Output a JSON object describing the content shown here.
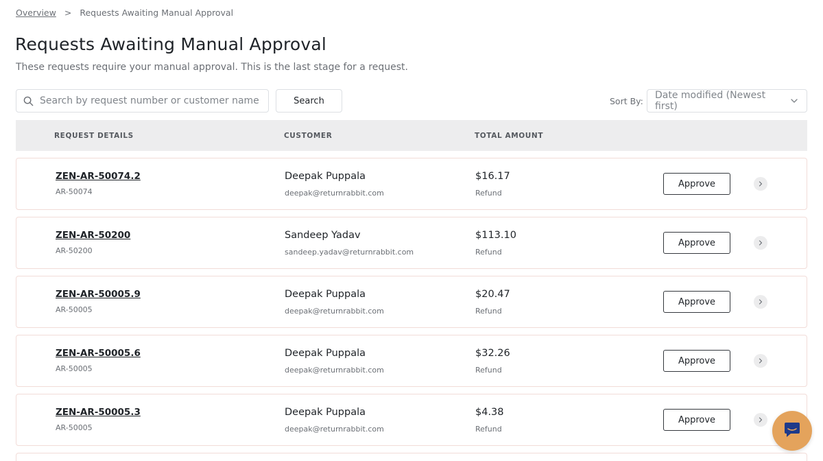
{
  "breadcrumb": {
    "home": "Overview",
    "separator": ">",
    "current": "Requests Awaiting Manual Approval"
  },
  "page": {
    "title": "Requests Awaiting Manual Approval",
    "subtitle": "These requests require your manual approval. This is the last stage for a request."
  },
  "search": {
    "placeholder": "Search by request number or customer name",
    "value": "",
    "button_label": "Search"
  },
  "sort": {
    "label": "Sort By:",
    "selected": "Date modified (Newest first)"
  },
  "table": {
    "headers": {
      "request_details": "REQUEST DETAILS",
      "customer": "CUSTOMER",
      "total_amount": "TOTAL AMOUNT"
    },
    "rows": [
      {
        "request_id": "ZEN-AR-50074.2",
        "sub_id": "AR-50074",
        "customer_name": "Deepak Puppala",
        "customer_email": "deepak@returnrabbit.com",
        "amount": "$16.17",
        "amount_type": "Refund",
        "action_label": "Approve"
      },
      {
        "request_id": "ZEN-AR-50200",
        "sub_id": "AR-50200",
        "customer_name": "Sandeep Yadav",
        "customer_email": "sandeep.yadav@returnrabbit.com",
        "amount": "$113.10",
        "amount_type": "Refund",
        "action_label": "Approve"
      },
      {
        "request_id": "ZEN-AR-50005.9",
        "sub_id": "AR-50005",
        "customer_name": "Deepak Puppala",
        "customer_email": "deepak@returnrabbit.com",
        "amount": "$20.47",
        "amount_type": "Refund",
        "action_label": "Approve"
      },
      {
        "request_id": "ZEN-AR-50005.6",
        "sub_id": "AR-50005",
        "customer_name": "Deepak Puppala",
        "customer_email": "deepak@returnrabbit.com",
        "amount": "$32.26",
        "amount_type": "Refund",
        "action_label": "Approve"
      },
      {
        "request_id": "ZEN-AR-50005.3",
        "sub_id": "AR-50005",
        "customer_name": "Deepak Puppala",
        "customer_email": "deepak@returnrabbit.com",
        "amount": "$4.38",
        "amount_type": "Refund",
        "action_label": "Approve"
      }
    ]
  },
  "icons": {
    "search": "search-icon",
    "sort_dropdown": "chevron-down-icon",
    "row_detail": "chevron-right-icon",
    "chat": "chat-icon"
  },
  "colors": {
    "header_bg": "#ededee",
    "row_border": "#f2dcd8",
    "chat_bubble": "#e4a35c",
    "chat_icon": "#1e3a8a"
  }
}
